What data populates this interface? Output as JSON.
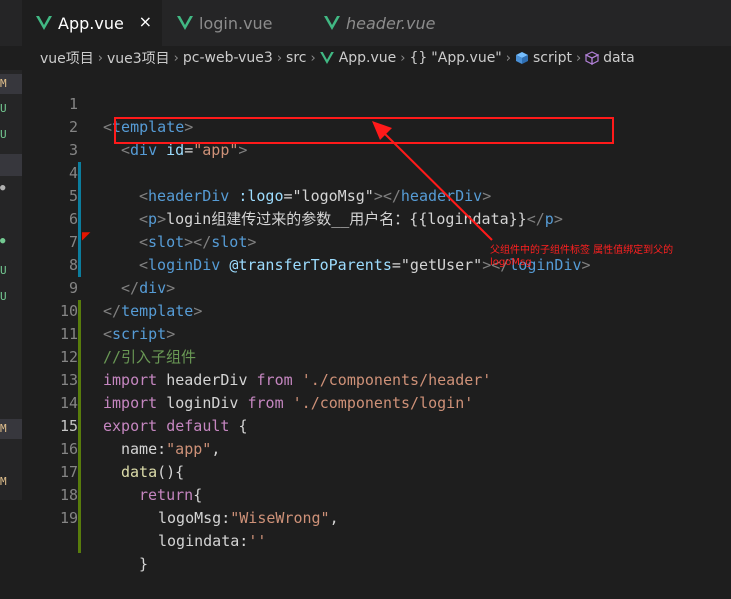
{
  "tabs": [
    {
      "label": "App.vue",
      "active": true,
      "close": "×"
    },
    {
      "label": "login.vue",
      "active": false
    },
    {
      "label": "header.vue",
      "active": false,
      "italic": true
    }
  ],
  "breadcrumb": {
    "items": [
      "vue项目",
      "vue3项目",
      "pc-web-vue3",
      "src",
      "App.vue",
      "\"App.vue\"",
      "script",
      "data"
    ],
    "braces": "{}",
    "separator": "›"
  },
  "left_gutter": [
    "M",
    "U",
    "U",
    "●",
    "●",
    "U",
    "U",
    "M",
    "M"
  ],
  "editor": {
    "current_line": 15,
    "lines": [
      {
        "n": "1"
      },
      {
        "n": "2"
      },
      {
        "n": "3"
      },
      {
        "n": "4"
      },
      {
        "n": "5"
      },
      {
        "n": "6"
      },
      {
        "n": "7"
      },
      {
        "n": "8"
      },
      {
        "n": "9"
      },
      {
        "n": "10"
      },
      {
        "n": "11"
      },
      {
        "n": "12"
      },
      {
        "n": "13"
      },
      {
        "n": "14"
      },
      {
        "n": "15"
      },
      {
        "n": "16"
      },
      {
        "n": "17"
      },
      {
        "n": "18"
      },
      {
        "n": "19"
      }
    ]
  },
  "code": {
    "l1": [
      "<",
      "template",
      ">"
    ],
    "l2": [
      "<",
      "div",
      "id",
      "=",
      "\"app\"",
      ">"
    ],
    "l3": [
      "<",
      "headerDiv",
      ":logo",
      "=",
      "\"logoMsg\"",
      "></",
      "headerDiv",
      ">"
    ],
    "l4": [
      "<",
      "p",
      ">",
      "login组建传过来的参数__用户名：{{logindata}}",
      "</",
      "p",
      ">"
    ],
    "l5": [
      "<",
      "slot",
      "></",
      "slot",
      ">"
    ],
    "l6": [
      "<",
      "loginDiv",
      "@transferToParents",
      "=",
      "\"getUser\"",
      "></",
      "loginDiv",
      ">"
    ],
    "l7": [
      "</",
      "div",
      ">"
    ],
    "l8": [
      "</",
      "template",
      ">"
    ],
    "l9": [
      "<",
      "script",
      ">"
    ],
    "l10": "//引入子组件",
    "l11": [
      "import",
      "headerDiv",
      "from",
      "'./components/header'"
    ],
    "l12": [
      "import",
      "loginDiv",
      "from",
      "'./components/login'"
    ],
    "l13": [
      "export",
      "default",
      "{"
    ],
    "l14": [
      "name:",
      "\"app\"",
      ","
    ],
    "l15": [
      "data",
      "(){"
    ],
    "l16": [
      "return",
      "{"
    ],
    "l17": [
      "logoMsg:",
      "\"WiseWrong\"",
      ","
    ],
    "l18": [
      "logindata:",
      "''"
    ],
    "l19": "}"
  },
  "annotation": {
    "line1": "父组件中的子组件标签  属性值绑定到父的",
    "line2": "logoMsg"
  },
  "colors": {
    "highlight_box": "#ff1a1a",
    "annotation_text": "#ff2020",
    "vue_green": "#41b883"
  }
}
